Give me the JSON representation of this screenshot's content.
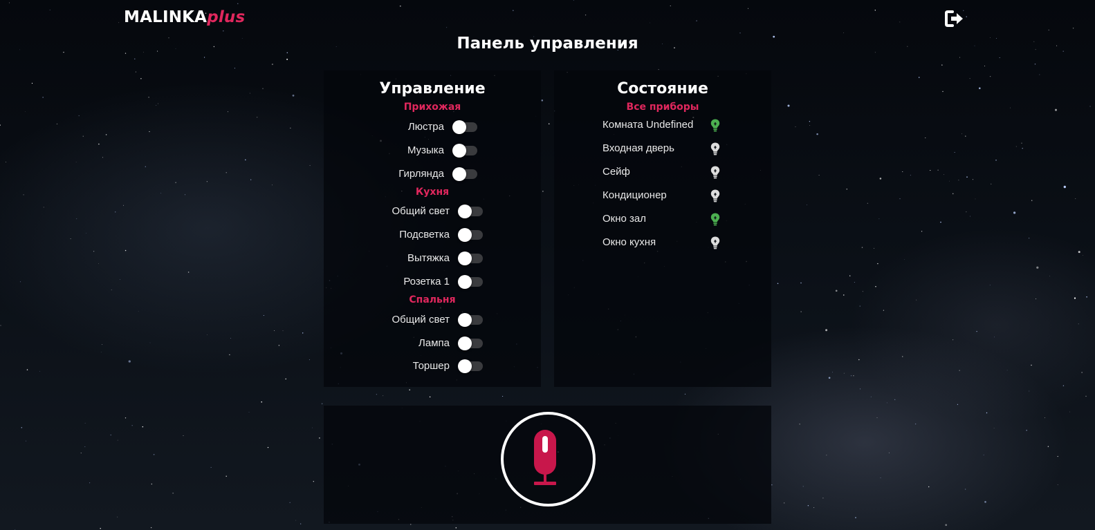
{
  "brand": {
    "name": "MALINKA",
    "suffix": "plus"
  },
  "header": {
    "logout_icon": "sign-out-icon"
  },
  "page_title": "Панель управления",
  "control_panel": {
    "heading": "Управление",
    "rooms": [
      {
        "title": "Прихожая",
        "devices": [
          {
            "label": "Люстра",
            "on": false
          },
          {
            "label": "Музыка",
            "on": false
          },
          {
            "label": "Гирлянда",
            "on": false
          }
        ]
      },
      {
        "title": "Кухня",
        "devices": [
          {
            "label": "Общий свет",
            "on": false
          },
          {
            "label": "Подсветка",
            "on": false
          },
          {
            "label": "Вытяжка",
            "on": false
          },
          {
            "label": "Розетка 1",
            "on": false
          }
        ]
      },
      {
        "title": "Спальня",
        "devices": [
          {
            "label": "Общий свет",
            "on": false
          },
          {
            "label": "Лампа",
            "on": false
          },
          {
            "label": "Торшер",
            "on": false
          }
        ]
      }
    ]
  },
  "status_panel": {
    "heading": "Состояние",
    "group_title": "Все приборы",
    "devices": [
      {
        "label": "Комната Undefined",
        "active": true
      },
      {
        "label": "Входная дверь",
        "active": false
      },
      {
        "label": "Сейф",
        "active": false
      },
      {
        "label": "Кондиционер",
        "active": false
      },
      {
        "label": "Окно зал",
        "active": true
      },
      {
        "label": "Окно кухня",
        "active": false
      }
    ]
  },
  "voice": {
    "icon": "microphone-icon"
  },
  "colors": {
    "accent": "#e0275d",
    "mic": "#c8174b",
    "bulb_on": "#4caf50",
    "bulb_off": "#dddddd",
    "toggle_track": "#3a3b3e"
  }
}
